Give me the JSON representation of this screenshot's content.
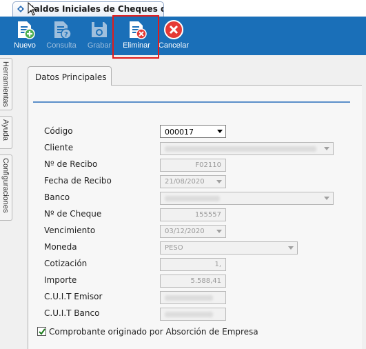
{
  "window": {
    "title": "Saldos Iniciales de Cheques de Te..."
  },
  "toolbar": {
    "nuevo": "Nuevo",
    "consulta": "Consulta",
    "grabar": "Grabar",
    "eliminar": "Eliminar",
    "cancelar": "Cancelar"
  },
  "side_tabs": {
    "herramientas": "Herramientas",
    "ayuda": "Ayuda",
    "configuraciones": "Configuraciones"
  },
  "tab": {
    "datos_principales": "Datos Principales"
  },
  "form": {
    "codigo": {
      "label": "Código",
      "value": "000017"
    },
    "cliente": {
      "label": "Cliente"
    },
    "recibo": {
      "label": "Nº de Recibo",
      "value": "F02110"
    },
    "fecha_recibo": {
      "label": "Fecha de Recibo",
      "value": "21/08/2020"
    },
    "banco": {
      "label": "Banco"
    },
    "cheque": {
      "label": "Nº de Cheque",
      "value": "155557"
    },
    "vencimiento": {
      "label": "Vencimiento",
      "value": "03/12/2020"
    },
    "moneda": {
      "label": "Moneda",
      "value": "PESO"
    },
    "cotizacion": {
      "label": "Cotización",
      "value": "1,"
    },
    "importe": {
      "label": "Importe",
      "value": "5.588,41"
    },
    "cuit_emisor": {
      "label": "C.U.I.T Emisor"
    },
    "cuit_banco": {
      "label": "C.U.I.T Banco"
    },
    "absorcion": {
      "label": "Comprobante originado por Absorción de Empresa",
      "checked": true
    }
  }
}
